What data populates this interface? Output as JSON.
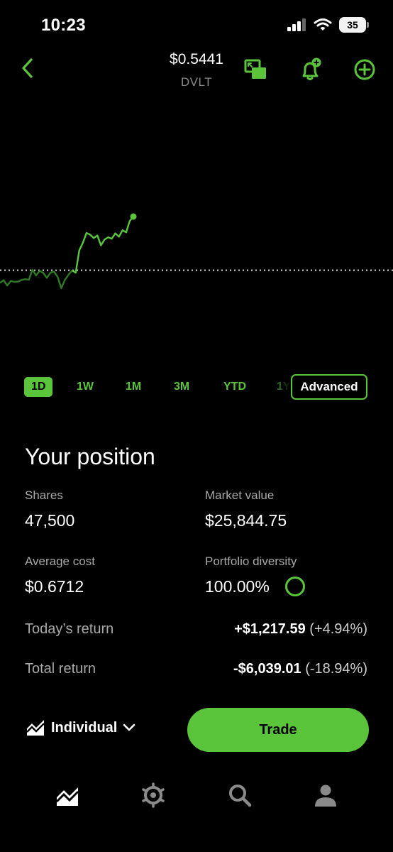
{
  "status_bar": {
    "time": "10:23",
    "battery": "35"
  },
  "header": {
    "price": "$0.5441",
    "symbol": "DVLT"
  },
  "ranges": [
    "1D",
    "1W",
    "1M",
    "3M",
    "YTD",
    "1Y"
  ],
  "active_range": "1D",
  "advanced_label": "Advanced",
  "position": {
    "title": "Your position",
    "shares_label": "Shares",
    "shares_value": "47,500",
    "market_value_label": "Market value",
    "market_value": "$25,844.75",
    "avg_cost_label": "Average cost",
    "avg_cost_value": "$0.6712",
    "diversity_label": "Portfolio diversity",
    "diversity_value": "100.00%",
    "todays_return_label": "Today’s return",
    "todays_return_amount": "+$1,217.59",
    "todays_return_pct": "(+4.94%)",
    "total_return_label": "Total return",
    "total_return_amount": "-$6,039.01",
    "total_return_pct": "(-18.94%)"
  },
  "account_label": "Individual",
  "trade_label": "Trade",
  "colors": {
    "accent": "#5ac53b",
    "dim_line": "#2e7a24",
    "background": "#000000"
  },
  "icons": {
    "back": "chevron-left-icon",
    "pip": "picture-in-picture-icon",
    "alert": "bell-plus-icon",
    "add": "plus-circle-icon",
    "account": "chart-area-icon",
    "tabs": [
      "investing-icon",
      "crypto-icon",
      "search-icon",
      "account-icon"
    ]
  },
  "chart_data": {
    "type": "line",
    "title": "",
    "xlabel": "",
    "ylabel": "",
    "baseline": 0.5182,
    "ylim": [
      0.48,
      0.6
    ],
    "x": [
      0,
      1,
      2,
      3,
      4,
      5,
      6,
      7,
      8,
      9,
      10,
      11,
      12,
      13,
      14,
      15,
      16,
      17,
      18,
      19,
      20,
      21,
      22,
      23,
      24,
      25,
      26,
      27,
      28,
      29,
      30,
      31,
      32,
      33,
      34,
      35,
      36,
      37,
      38,
      39,
      40,
      41,
      42,
      43,
      44,
      45,
      46,
      47,
      48,
      49,
      50
    ],
    "series": [
      {
        "values": [
          0.5121,
          0.5134,
          0.5108,
          0.513,
          0.5126,
          0.5127,
          0.5135,
          0.5139,
          0.5136,
          0.5184,
          0.5157,
          0.5179,
          0.5169,
          0.5145,
          0.517,
          0.5175,
          0.515,
          0.5095,
          0.5135,
          0.516,
          0.5181,
          0.517,
          0.5278,
          0.5315,
          0.5362,
          0.5354,
          0.5337,
          0.535,
          0.5302,
          0.533,
          0.5341,
          0.5334,
          0.536,
          0.5344,
          0.5375,
          0.5365,
          0.542,
          0.5441
        ]
      }
    ],
    "grid": false,
    "legend": "none"
  }
}
